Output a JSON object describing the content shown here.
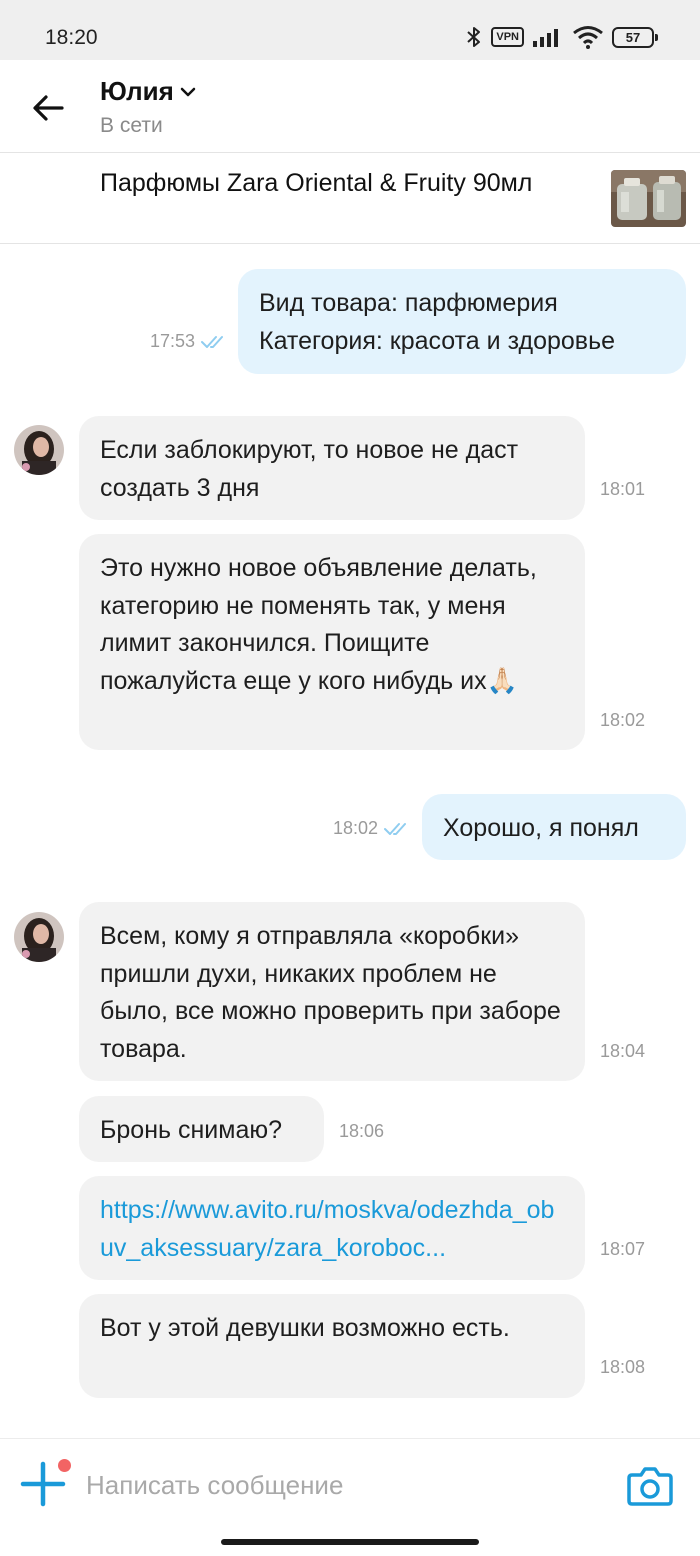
{
  "status_bar": {
    "time": "18:20",
    "vpn_label": "VPN",
    "battery_level": "57",
    "icons": [
      "bluetooth-icon",
      "vpn-icon",
      "signal-icon",
      "wifi-icon",
      "battery-icon"
    ]
  },
  "header": {
    "contact_name": "Юлия",
    "contact_status": "В сети",
    "icons": [
      "back-arrow-icon",
      "chevron-down-icon"
    ]
  },
  "item": {
    "title": "Парфюмы Zara Oriental & Fruity 90мл",
    "thumbnail_icon": "perfume-bottles-photo"
  },
  "messages": [
    {
      "direction": "out",
      "lines": [
        "Вид товара: парфюмерия",
        "Категория: красота и здоровье"
      ],
      "time": "17:53",
      "read": true
    },
    {
      "direction": "in",
      "avatar": true,
      "text": "Если заблокируют, то новое не даст создать 3 дня",
      "time": "18:01"
    },
    {
      "direction": "in",
      "text": "Это нужно новое объявление делать, категорию не поменять так, у меня лимит закончился. Поищите пожалуйста еще у кого нибудь их",
      "emoji": "🙏🏻",
      "time": "18:02"
    },
    {
      "direction": "out",
      "text": "Хорошо, я понял",
      "time": "18:02",
      "read": true
    },
    {
      "direction": "in",
      "avatar": true,
      "text": "Всем, кому я отправляла «коробки» пришли духи, никаких проблем не было, все можно проверить при заборе товара.",
      "time": "18:04"
    },
    {
      "direction": "in",
      "text": "Бронь снимаю?",
      "time": "18:06"
    },
    {
      "direction": "in",
      "link": "https://www.avito.ru/moskva/odezhda_obuv_aksessuary/zara_koroboc...",
      "time": "18:07"
    },
    {
      "direction": "in",
      "text": "Вот у этой девушки возможно есть.",
      "time": "18:08"
    }
  ],
  "composer": {
    "placeholder": "Написать сообщение",
    "value": "",
    "icons": [
      "plus-icon",
      "camera-icon"
    ]
  },
  "colors": {
    "accent": "#1a9ad9",
    "outgoing_bubble": "#e3f3fd",
    "incoming_bubble": "#f2f2f2",
    "status_bar_bg": "#efefef",
    "notification_dot": "#f26464"
  }
}
